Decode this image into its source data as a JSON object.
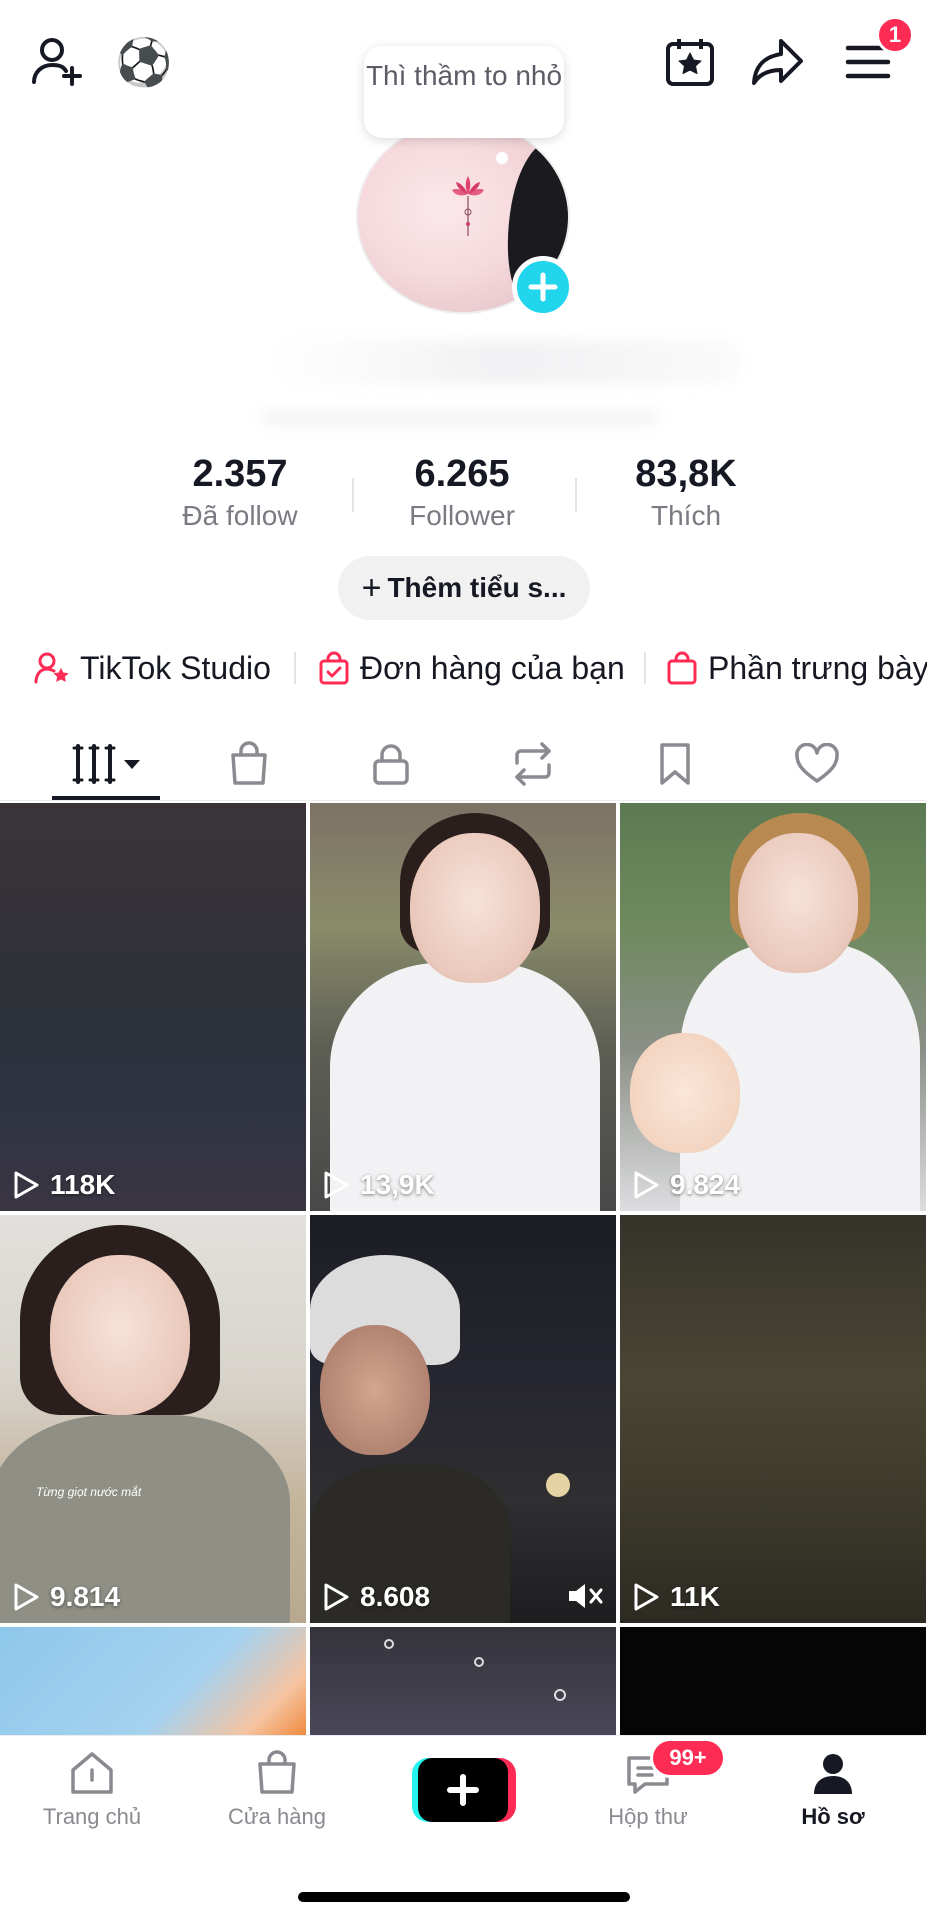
{
  "header": {
    "add_user_icon": "add-user-icon",
    "ball_emoji": "⚽",
    "menu_badge": "1"
  },
  "profile": {
    "status_bubble": "Thì thầm to nhỏ"
  },
  "stats": [
    {
      "value": "2.357",
      "label": "Đã follow"
    },
    {
      "value": "6.265",
      "label": "Follower"
    },
    {
      "value": "83,8K",
      "label": "Thích"
    }
  ],
  "bio_button": {
    "plus": "+",
    "label": "Thêm tiểu s..."
  },
  "quick_links": [
    {
      "label": "TikTok Studio"
    },
    {
      "label": "Đơn hàng của bạn"
    },
    {
      "label": "Phần trưng bày"
    }
  ],
  "videos": [
    {
      "views": "118K"
    },
    {
      "views": "13,9K"
    },
    {
      "views": "9.824"
    },
    {
      "views": "9.814"
    },
    {
      "views": "8.608"
    },
    {
      "views": "11K"
    }
  ],
  "video_caption_4": "Từng giọt nước mắt",
  "bottom_nav": {
    "home": "Trang chủ",
    "shop": "Cửa hàng",
    "inbox": "Hộp thư",
    "inbox_badge": "99+",
    "profile": "Hồ sơ"
  },
  "colors": {
    "accent_red": "#fe2c55",
    "accent_cyan": "#20d5ec",
    "text_primary": "#161823",
    "text_secondary": "#7a7b82"
  }
}
